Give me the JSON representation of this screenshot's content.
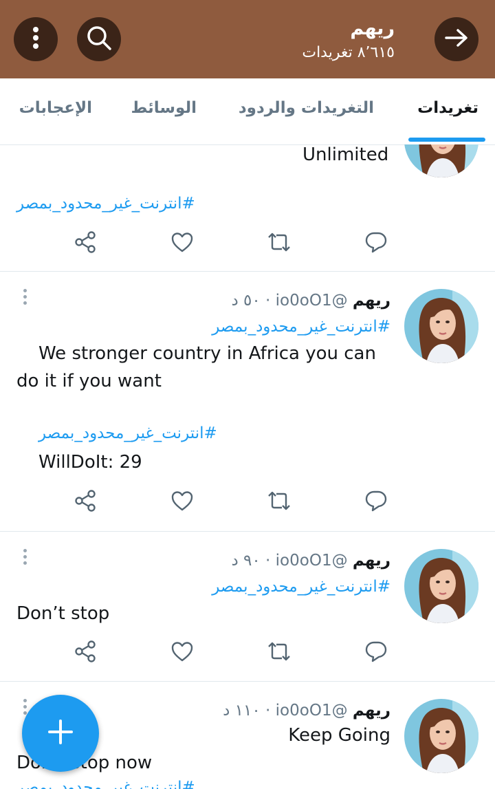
{
  "header": {
    "name": "ريهم",
    "tweet_count": "٨٬٦١٥ تغريدات",
    "back_icon": "arrow-right-icon",
    "search_icon": "search-icon",
    "more_icon": "more-vertical-icon"
  },
  "tabs": [
    {
      "label": "تغريدات",
      "active": true
    },
    {
      "label": "التغريدات والردود",
      "active": false
    },
    {
      "label": "الوسائط",
      "active": false
    },
    {
      "label": "الإعجابات",
      "active": false
    }
  ],
  "tweets": [
    {
      "partial_text": "Unlimited",
      "hashtag": "#انترنت_غير_محدود_بمصر"
    },
    {
      "name": "ريهم",
      "handle": "@io0oO1",
      "time": "٥٠ د",
      "hashtag1": "#انترنت_غير_محدود_بمصر",
      "text_line1": "We stronger country in Africa you can",
      "text_line2": "do it if you want",
      "hashtag2": "#انترنت_غير_محدود_بمصر",
      "text_line3": "WillDoIt: 29"
    },
    {
      "name": "ريهم",
      "handle": "@io0oO1",
      "time": "٩٠ د",
      "hashtag1": "#انترنت_غير_محدود_بمصر",
      "text_line1": "Don’t stop"
    },
    {
      "name": "ريهم",
      "handle": "@io0oO1",
      "time": "١١٠ د",
      "text_line1": "Keep Going",
      "text_line2": "Don’t stop now",
      "hashtag_partial": "#انترنت_غير_محدود_بمصر"
    }
  ],
  "actions": [
    "reply-icon",
    "retweet-icon",
    "like-icon",
    "share-icon"
  ],
  "colors": {
    "header": "#8f5b3e",
    "header_button": "#3b2418",
    "accent": "#1d9bf0",
    "secondary_text": "#657786"
  },
  "fab": {
    "icon": "compose-plus-icon"
  }
}
